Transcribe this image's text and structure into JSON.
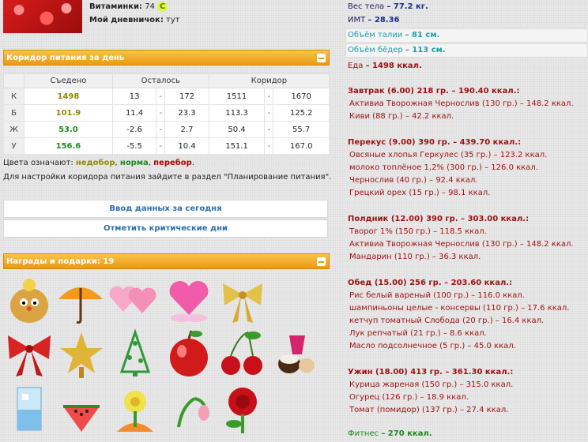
{
  "profile": {
    "vitamins_label": "Витаминки:",
    "vitamins_value": "74",
    "vitamins_badge": "C",
    "diary_label": "Мой дневничок:",
    "diary_value": "тут"
  },
  "corridor": {
    "title": "Коридор питания за день",
    "columns": [
      "",
      "Съедено",
      "Осталось",
      "Коридор"
    ],
    "rows": [
      {
        "label": "К",
        "eaten": "1498",
        "color": "#8f8c00",
        "left_min": "13",
        "left_max": "172",
        "corr_min": "1511",
        "corr_max": "1670"
      },
      {
        "label": "Б",
        "eaten": "101.9",
        "color": "#8f8c00",
        "left_min": "11.4",
        "left_max": "23.3",
        "corr_min": "113.3",
        "corr_max": "125.2"
      },
      {
        "label": "Ж",
        "eaten": "53.0",
        "color": "#1e8a1e",
        "left_min": "-2.6",
        "left_max": "2.7",
        "corr_min": "50.4",
        "corr_max": "55.7"
      },
      {
        "label": "У",
        "eaten": "156.6",
        "color": "#1e8a1e",
        "left_min": "-5.5",
        "left_max": "10.4",
        "corr_min": "151.1",
        "corr_max": "167.0"
      }
    ],
    "dash": "-",
    "legend_prefix": "Цвета означают:",
    "legend_under": "недобор",
    "legend_norm": "норма",
    "legend_over": "перебор",
    "settings_note": "Для настройки коридора питания зайдите в раздел \"Планирование питания\".",
    "enter_data_button": "Ввод данных за сегодня",
    "critical_days_button": "Отметить критические дни"
  },
  "gifts": {
    "title": "Награды и подарки: 19",
    "items": [
      "scarecrow-gift",
      "umbrella-gift",
      "hearts-gift",
      "heart-gift",
      "bow-gift",
      "ribbon-gift",
      "star-gift",
      "tree-gift",
      "apple-gift",
      "cherry-gift",
      "candy-gift",
      "glass-gift",
      "watermelon-gift",
      "flower-gift",
      "tulip-gift",
      "rose-gift"
    ]
  },
  "diary": {
    "weight_label": "Вес тела",
    "weight_value": "– 77.2 кг.",
    "bmi_label": "ИМТ",
    "bmi_value": "– 28.36",
    "waist_label": "Объём талии",
    "waist_value": "– 81 см.",
    "hips_label": "Объём бёдер",
    "hips_value": "– 113 см.",
    "food_label": "Еда",
    "food_value": "– 1498 ккал.",
    "meals": [
      {
        "title": "Завтрак (6.00) 218 гр. – 190.40 ккал.:",
        "items": [
          "Активиа Творожная Чернослив (130 гр.) – 148.2 ккал.",
          "Киви (88 гр.) – 42.2 ккал."
        ]
      },
      {
        "title": "Перекус (9.00) 390 гр. – 439.70 ккал.:",
        "items": [
          "Овсяные хлопья Геркулес (35 гр.) – 123.2 ккал.",
          "молоко топлёное 1,2% (300 гр.) – 126.0 ккал.",
          "Чернослив (40 гр.) – 92.4 ккал.",
          "Грецкий орех (15 гр.) – 98.1 ккал."
        ]
      },
      {
        "title": "Полдник (12.00) 390 гр. – 303.00 ккал.:",
        "items": [
          "Творог 1% (150 гр.) – 118.5 ккал.",
          "Активиа Творожная Чернослив (130 гр.) – 148.2 ккал.",
          "Мандарин (110 гр.) – 36.3 ккал."
        ]
      },
      {
        "title": "Обед (15.00) 256 гр. – 203.60 ккал.:",
        "items": [
          "Рис белый вареный (100 гр.) – 116.0 ккал.",
          "шампиньоны целые - консервы (110 гр.) – 17.6 ккал.",
          "кетчуп томатный Слобода (20 гр.) – 16.4 ккал.",
          "Лук репчатый (21 гр.) – 8.6 ккал.",
          "Масло подсолнечное (5 гр.) – 45.0 ккал."
        ]
      },
      {
        "title": "Ужин (18.00) 413 гр. – 361.30 ккал.:",
        "items": [
          "Курица жареная (150 гр.) – 315.0 ккал.",
          "Огурец (126 гр.) – 18.9 ккал.",
          "Томат (помидор) (137 гр.) – 27.4 ккал."
        ]
      }
    ],
    "fitness_label": "Фитнес",
    "fitness_value": "– 270 ккал."
  }
}
